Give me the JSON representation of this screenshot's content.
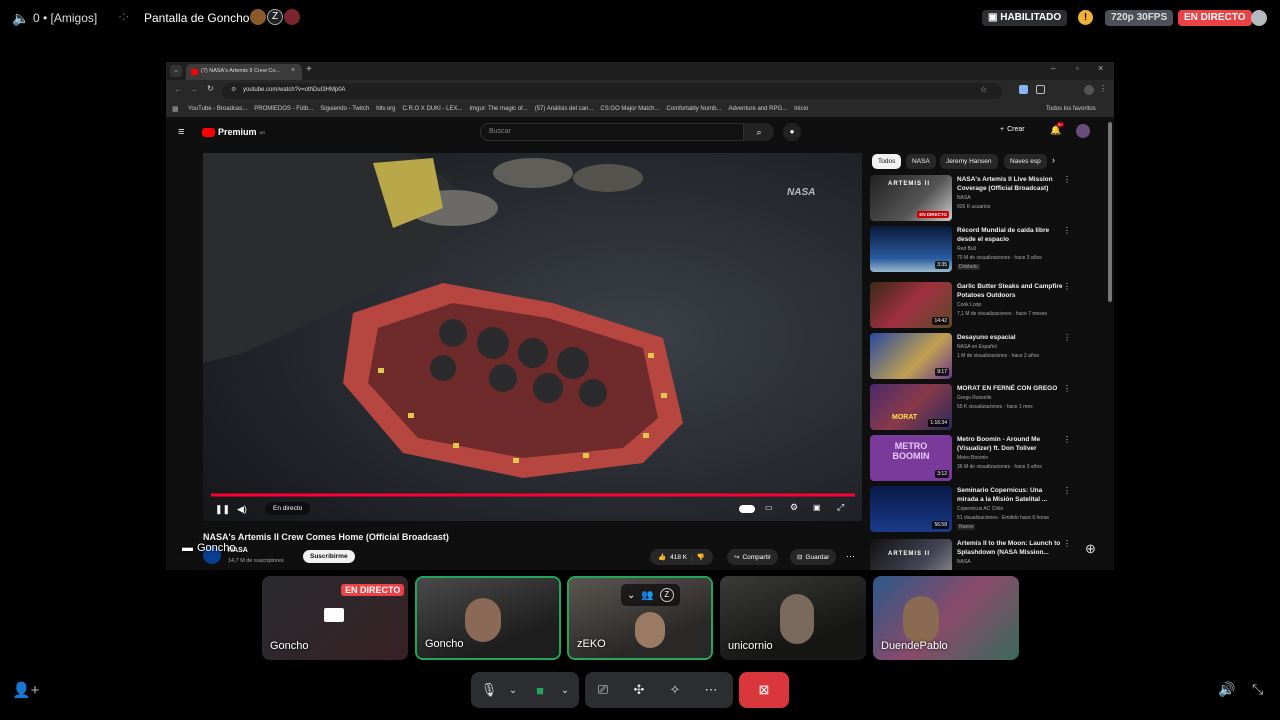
{
  "topbar": {
    "server_prefix": "0 • [Amigos]",
    "stream_title": "Pantalla de Goncho",
    "enabled_label": "HABILITADO",
    "quality": "720p 30FPS",
    "live_badge": "EN DIRECTO"
  },
  "browser": {
    "tab_title": "(7) NASA's Artemis II Crew Co...",
    "url": "youtube.com/watch?v=othDuI3HMp0A",
    "bookmarks": [
      "YouTube - Broadcas...",
      "PROMIEDOS - Fútb...",
      "Siguiendo - Twitch",
      "hltv.org",
      "C.R.O X DUKI - LEX...",
      "Imgur: The magic of...",
      "(57) Análisis del can...",
      "CS:GO Major Match...",
      "Comfortably Numb...",
      "Adventure and RPG...",
      "Inicio"
    ],
    "all_favorites": "Todos los favoritos"
  },
  "youtube": {
    "logo": "Premium",
    "logo_sup": "AR",
    "search_placeholder": "Buscar",
    "create_label": "Crear",
    "notif_count": "9+",
    "player_watermark": "NASA",
    "live_label": "En directo",
    "video_title": "NASA's Artemis II Crew Comes Home (Official Broadcast)",
    "channel": "NASA",
    "subscribers": "14,7 M de suscriptores",
    "subscribe_label": "Suscribirme",
    "likes": "418 K",
    "share_label": "Compartir",
    "save_label": "Guardar",
    "chips": [
      "Todos",
      "NASA",
      "Jeremy Hansen",
      "Naves esp"
    ],
    "sidebar_videos": [
      {
        "title": "NASA's Artemis II Live Mission Coverage (Official Broadcast)",
        "channel": "NASA",
        "meta": "926 K usuarios",
        "badge": "EN DIRECTO",
        "thumb_text": "ARTEMIS II"
      },
      {
        "title": "Récord Mundial de caída libre desde el espacio",
        "channel": "Red Bull",
        "meta": "70 M de visualizaciones · hace 3 años",
        "extra": "Doblado",
        "duration": "3:35"
      },
      {
        "title": "Garlic Butter Steaks and Campfire Potatoes Outdoors",
        "channel": "Cook Loop",
        "meta": "7,1 M de visualizaciones · hace 7 meses",
        "duration": "14:42"
      },
      {
        "title": "Desayuno espacial",
        "channel": "NASA en Español",
        "meta": "1 M de visualizaciones · hace 2 años",
        "duration": "9:17"
      },
      {
        "title": "MORAT EN FERNÉ CON GREGO",
        "channel": "Grego Rossello",
        "meta": "55 K visualizaciones · hace 1 mes",
        "duration": "1:16:34",
        "thumb_text": "MORAT"
      },
      {
        "title": "Metro Boomin - Around Me (Visualizer) ft. Don Toliver",
        "channel": "Metro Boomin",
        "meta": "36 M de visualizaciones · hace 3 años",
        "duration": "3:12",
        "thumb_text": "METRO BOOMIN"
      },
      {
        "title": "Seminario Copernicus: Una mirada a la Misión Satelital ...",
        "channel": "Copernicus AC Chile",
        "meta": "51 visualizaciones · Emitido hace 6 horas",
        "extra": "Nuevo",
        "duration": "56:58"
      },
      {
        "title": "Artemis II to the Moon: Launch to Splashdown (NASA Mission...",
        "channel": "NASA",
        "meta": "",
        "thumb_text": "ARTEMIS II"
      }
    ]
  },
  "overlay": {
    "screen_label": "Goncho"
  },
  "participants": [
    {
      "name": "Goncho",
      "live": "EN DIRECTO",
      "type": "screen"
    },
    {
      "name": "Goncho",
      "type": "cam",
      "selected": true
    },
    {
      "name": "zEKO",
      "type": "cam",
      "selected": true
    },
    {
      "name": "unicornio",
      "type": "cam"
    },
    {
      "name": "DuendePablo",
      "type": "cam"
    }
  ],
  "colors": {
    "live_red": "#ed4245",
    "accent_green": "#23a55a",
    "yt_red": "#ff0000",
    "warning_yellow": "#f0b232",
    "quality_gray": "#4e5058"
  }
}
